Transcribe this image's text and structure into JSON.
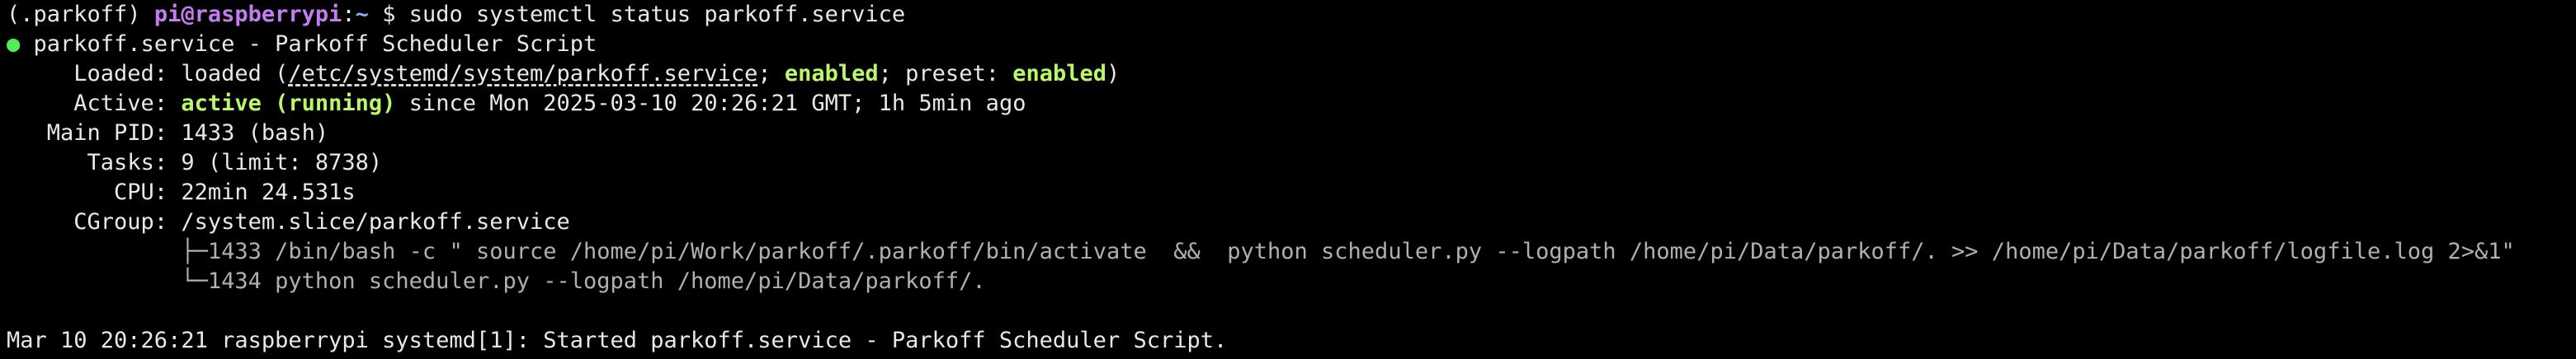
{
  "prompt": {
    "venv": "(.parkoff)",
    "user_host": "pi@raspberrypi",
    "sep": ":",
    "cwd": "~",
    "dollar": "$",
    "command": "sudo systemctl status parkoff.service"
  },
  "service": {
    "bullet": "●",
    "header": "parkoff.service - Parkoff Scheduler Script",
    "loaded_label": "Loaded:",
    "loaded_prefix": "loaded (",
    "loaded_path": "/etc/systemd/system/parkoff.service",
    "loaded_sep1": "; ",
    "loaded_enabled": "enabled",
    "loaded_sep2": "; preset: ",
    "loaded_preset": "enabled",
    "loaded_suffix": ")",
    "active_label": "Active:",
    "active_state": "active (running)",
    "active_since": "since Mon 2025-03-10 20:26:21 GMT; 1h 5min ago",
    "pid_label": "Main PID:",
    "pid_value": "1433 (bash)",
    "tasks_label": "Tasks:",
    "tasks_value": "9 (limit: 8738)",
    "cpu_label": "CPU:",
    "cpu_value": "22min 24.531s",
    "cgroup_label": "CGroup:",
    "cgroup_value": "/system.slice/parkoff.service",
    "proc1_branch": "├─",
    "proc1": "1433 /bin/bash -c \" source /home/pi/Work/parkoff/.parkoff/bin/activate  &&  python scheduler.py --logpath /home/pi/Data/parkoff/. >> /home/pi/Data/parkoff/logfile.log 2>&1\"",
    "proc2_branch": "└─",
    "proc2": "1434 python scheduler.py --logpath /home/pi/Data/parkoff/."
  },
  "log": {
    "line": "Mar 10 20:26:21 raspberrypi systemd[1]: Started parkoff.service - Parkoff Scheduler Script."
  }
}
